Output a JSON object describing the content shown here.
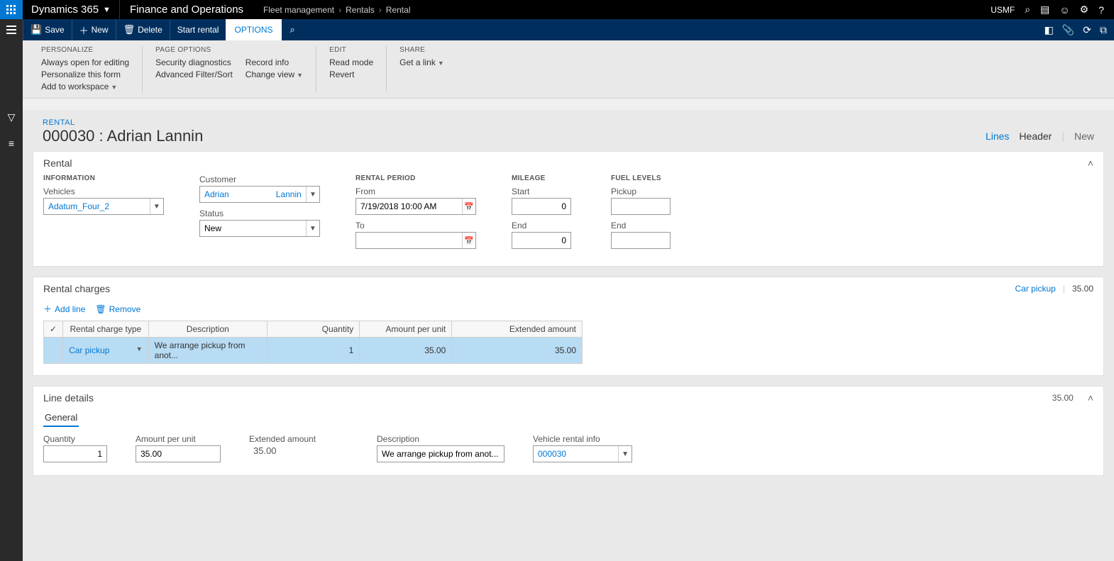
{
  "topbar": {
    "product": "Dynamics 365",
    "module": "Finance and Operations",
    "breadcrumb": [
      "Fleet management",
      "Rentals",
      "Rental"
    ],
    "company": "USMF"
  },
  "actionpane": {
    "save": "Save",
    "new": "New",
    "delete": "Delete",
    "start_rental": "Start rental",
    "options": "OPTIONS"
  },
  "ribbon": {
    "personalize": {
      "title": "PERSONALIZE",
      "always_open": "Always open for editing",
      "personalize_form": "Personalize this form",
      "add_workspace": "Add to workspace"
    },
    "page_options": {
      "title": "PAGE OPTIONS",
      "security": "Security diagnostics",
      "advanced_filter": "Advanced Filter/Sort",
      "record_info": "Record info",
      "change_view": "Change view"
    },
    "edit": {
      "title": "EDIT",
      "read_mode": "Read mode",
      "revert": "Revert"
    },
    "share": {
      "title": "SHARE",
      "get_link": "Get a link"
    }
  },
  "page": {
    "supertitle": "RENTAL",
    "title": "000030 : Adrian Lannin",
    "view_lines": "Lines",
    "view_header": "Header",
    "view_new": "New"
  },
  "rental_card": {
    "title": "Rental",
    "information": {
      "title": "INFORMATION",
      "vehicles_label": "Vehicles",
      "vehicles_value": "Adatum_Four_2",
      "customer_label": "Customer",
      "customer_first": "Adrian",
      "customer_last": "Lannin",
      "status_label": "Status",
      "status_value": "New"
    },
    "rental_period": {
      "title": "RENTAL PERIOD",
      "from_label": "From",
      "from_value": "7/19/2018 10:00 AM",
      "to_label": "To",
      "to_value": ""
    },
    "mileage": {
      "title": "MILEAGE",
      "start_label": "Start",
      "start_value": "0",
      "end_label": "End",
      "end_value": "0"
    },
    "fuel": {
      "title": "FUEL LEVELS",
      "pickup_label": "Pickup",
      "pickup_value": "",
      "end_label": "End",
      "end_value": ""
    }
  },
  "charges_card": {
    "title": "Rental charges",
    "summary_type": "Car pickup",
    "summary_amount": "35.00",
    "toolbar": {
      "add": "Add line",
      "remove": "Remove"
    },
    "columns": {
      "charge_type": "Rental charge type",
      "description": "Description",
      "quantity": "Quantity",
      "amount_per_unit": "Amount per unit",
      "extended_amount": "Extended amount"
    },
    "row": {
      "charge_type": "Car pickup",
      "description": "We arrange pickup from anot...",
      "quantity": "1",
      "amount_per_unit": "35.00",
      "extended_amount": "35.00"
    }
  },
  "line_details": {
    "title": "Line details",
    "amount": "35.00",
    "tab_general": "General",
    "quantity_label": "Quantity",
    "quantity_value": "1",
    "apu_label": "Amount per unit",
    "apu_value": "35.00",
    "ext_label": "Extended amount",
    "ext_value": "35.00",
    "desc_label": "Description",
    "desc_value": "We arrange pickup from anot...",
    "vri_label": "Vehicle rental info",
    "vri_value": "000030"
  }
}
